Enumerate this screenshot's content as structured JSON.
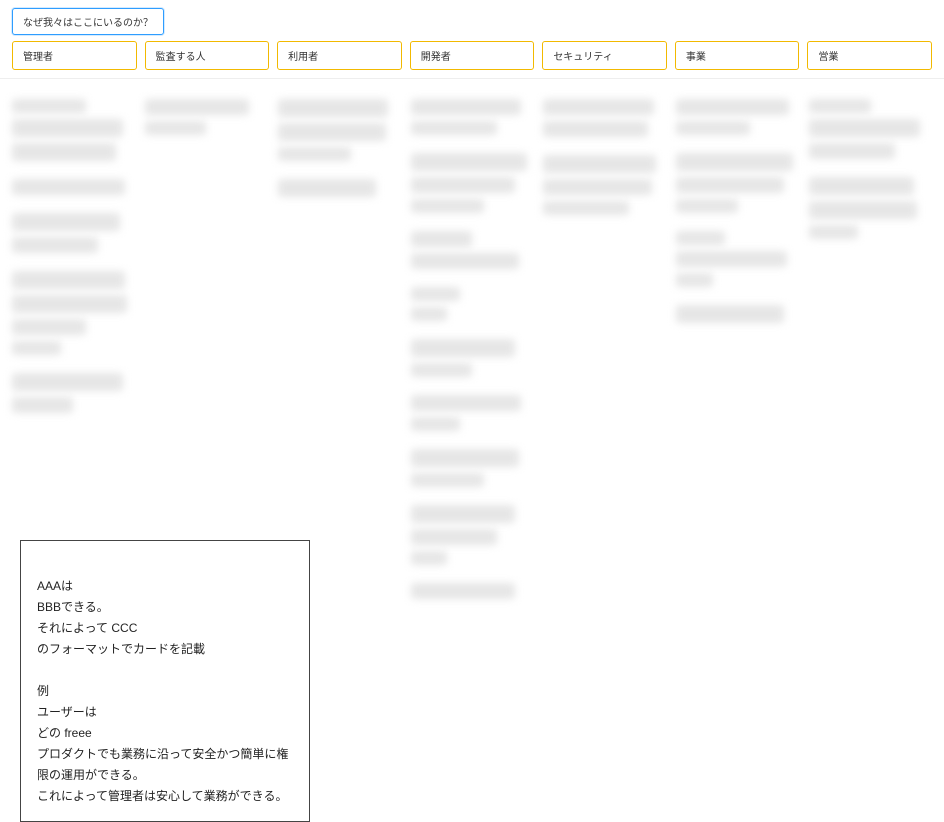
{
  "header": {
    "title": "なぜ我々はここにいるのか？"
  },
  "tabs": [
    {
      "label": "管理者"
    },
    {
      "label": "監査する人"
    },
    {
      "label": "利用者"
    },
    {
      "label": "開発者"
    },
    {
      "label": "セキュリティ"
    },
    {
      "label": "事業"
    },
    {
      "label": "営業"
    }
  ],
  "note": {
    "text": "AAAは\nBBBできる。\nそれによって CCC\nのフォーマットでカードを記載\n\n例\nユーザーは\nどの freee\nプロダクトでも業務に沿って安全かつ簡単に権限の運用ができる。\nこれによって管理者は安心して業務ができる。"
  }
}
